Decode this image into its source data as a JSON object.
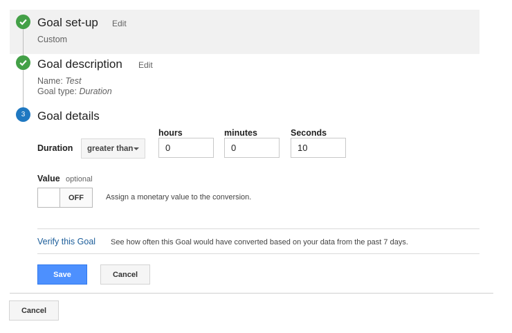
{
  "steps": [
    {
      "number": "",
      "title": "Goal set-up",
      "edit": "Edit",
      "summary": "Custom"
    },
    {
      "number": "",
      "title": "Goal description",
      "edit": "Edit",
      "name_label": "Name:",
      "name_value": "Test",
      "type_label": "Goal type:",
      "type_value": "Duration"
    },
    {
      "number": "3",
      "title": "Goal details"
    }
  ],
  "duration": {
    "label": "Duration",
    "comparator": "greater than",
    "hours_label": "hours",
    "hours_value": "0",
    "minutes_label": "minutes",
    "minutes_value": "0",
    "seconds_label": "Seconds",
    "seconds_value": "10"
  },
  "value": {
    "label": "Value",
    "optional": "optional",
    "toggle_state": "OFF",
    "description": "Assign a monetary value to the conversion."
  },
  "verify": {
    "link": "Verify this Goal",
    "description": "See how often this Goal would have converted based on your data from the past 7 days."
  },
  "buttons": {
    "save": "Save",
    "cancel": "Cancel",
    "outer_cancel": "Cancel"
  },
  "colors": {
    "check": "#43a047",
    "step_number": "#1f78c1",
    "link": "#1a5c99",
    "primary": "#4d90fe"
  }
}
